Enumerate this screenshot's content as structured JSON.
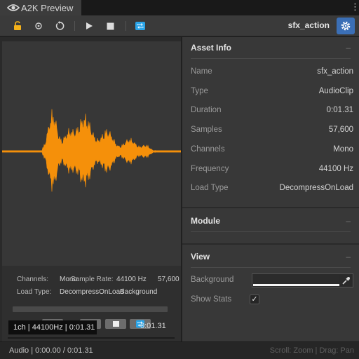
{
  "window": {
    "tab_title": "A2K Preview",
    "more_menu_icon": "kebab-menu-icon"
  },
  "toolbar": {
    "asset_name": "sfx_action",
    "icons": [
      "lock-icon",
      "record-icon",
      "reset-icon",
      "play-icon",
      "stop-icon",
      "loop-icon",
      "gear-icon"
    ],
    "accent_color": "#3b6fb6",
    "loop_color": "#2aa4e8"
  },
  "preview": {
    "waveform_color": "#f5900a",
    "overlay": {
      "channels_label": "Channels:",
      "channels_value": "Mono",
      "sample_rate_label": "Sample Rate:",
      "sample_rate_value": "44100 Hz",
      "samples_value": "57,600",
      "load_type_label": "Load Type:",
      "load_type_value": "DecompressOnLoad",
      "load_background": "Background"
    },
    "stats_text": "1ch | 44100Hz | 0:01.31",
    "mini_time": "0:01.31"
  },
  "inspector": {
    "asset_info": {
      "title": "Asset Info",
      "collapse_glyph": "–",
      "rows": [
        {
          "label": "Name",
          "value": "sfx_action"
        },
        {
          "label": "Type",
          "value": "AudioClip"
        },
        {
          "label": "Duration",
          "value": "0:01.31"
        },
        {
          "label": "Samples",
          "value": "57,600"
        },
        {
          "label": "Channels",
          "value": "Mono"
        },
        {
          "label": "Frequency",
          "value": "44100 Hz"
        },
        {
          "label": "Load Type",
          "value": "DecompressOnLoad"
        }
      ]
    },
    "module": {
      "title": "Module",
      "collapse_glyph": "–"
    },
    "view": {
      "title": "View",
      "collapse_glyph": "–",
      "background_label": "Background",
      "show_stats_label": "Show Stats",
      "show_stats_checked": true,
      "check_glyph": "✓"
    }
  },
  "statusbar": {
    "left": "Audio | 0:00.00 / 0:01.31",
    "right": "Scroll: Zoom | Drag: Pan"
  }
}
